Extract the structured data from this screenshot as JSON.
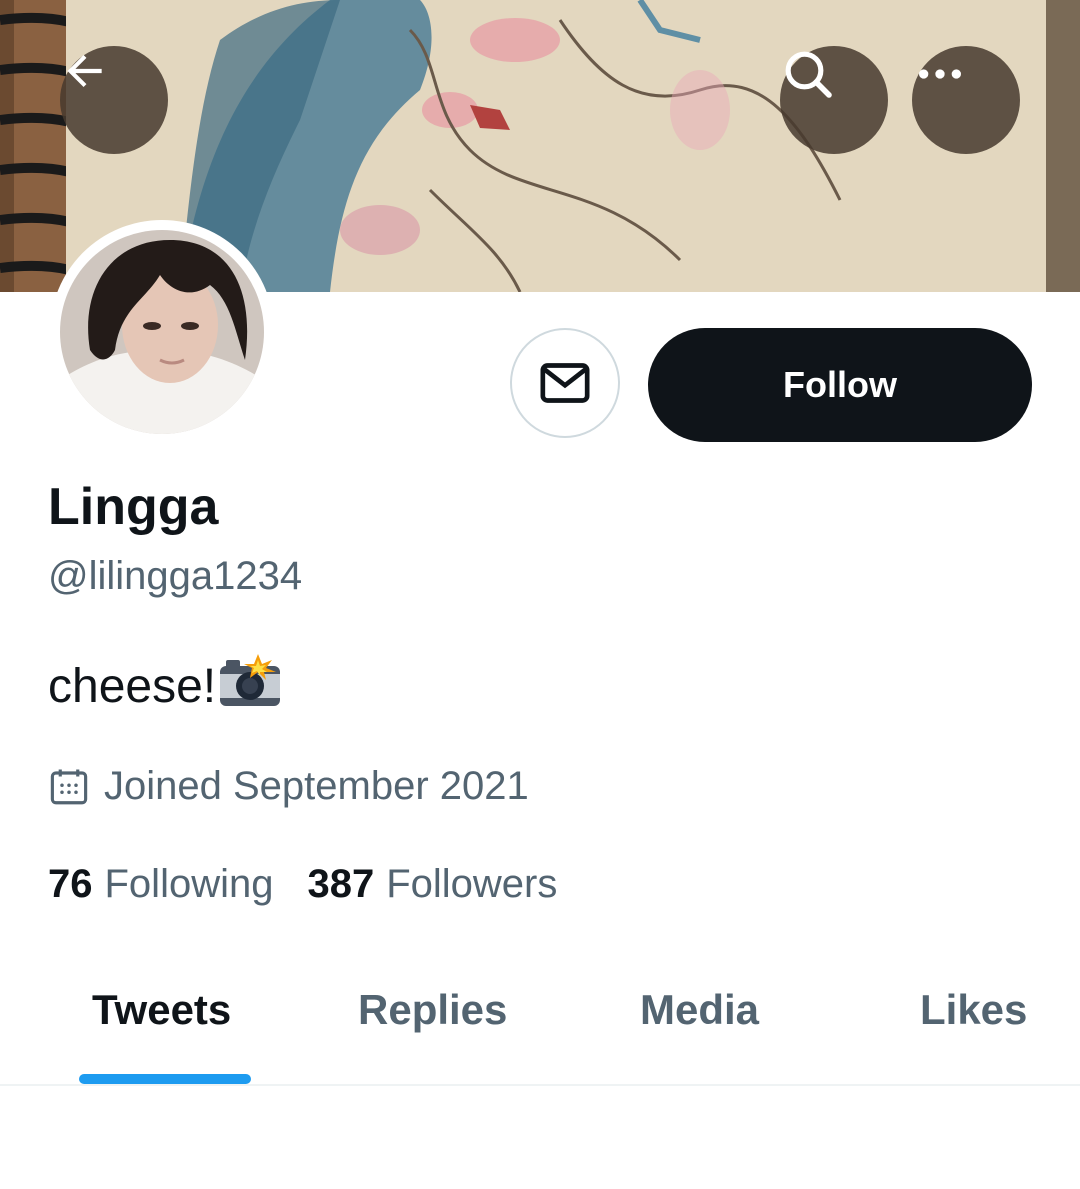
{
  "profile": {
    "name": "Lingga",
    "handle": "@lilingga1234",
    "bio": "cheese!",
    "bio_emoji": "camera-with-flash",
    "joined": "Joined September 2021"
  },
  "stats": {
    "following_count": "76",
    "following_label": "Following",
    "followers_count": "387",
    "followers_label": "Followers"
  },
  "actions": {
    "follow_label": "Follow",
    "message_icon": "envelope-icon"
  },
  "header_icons": [
    "back-arrow-icon",
    "search-icon",
    "more-icon"
  ],
  "tabs": [
    {
      "label": "Tweets",
      "active": true
    },
    {
      "label": "Replies",
      "active": false
    },
    {
      "label": "Media",
      "active": false
    },
    {
      "label": "Likes",
      "active": false
    }
  ],
  "colors": {
    "primary_text": "#0f1419",
    "secondary_text": "#536471",
    "accent": "#1d9bf0",
    "follow_button": "#0f1419"
  }
}
